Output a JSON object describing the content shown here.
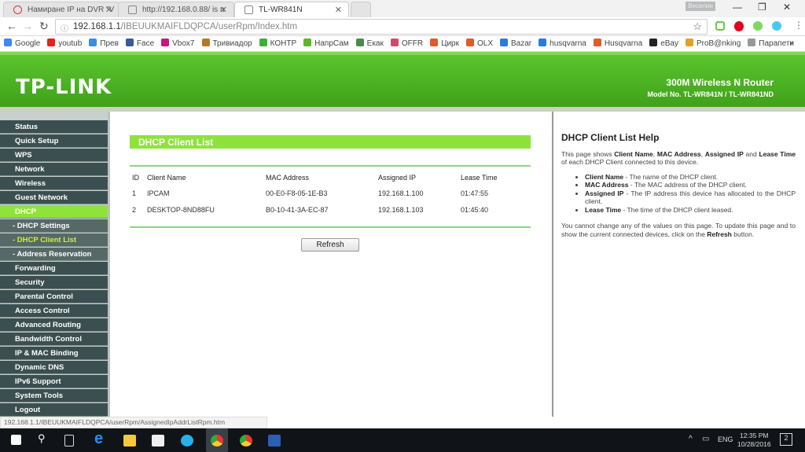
{
  "browser": {
    "tabs": [
      {
        "title": "Намиране IP на DVR \"V"
      },
      {
        "title": "http://192.168.0.88/ is n"
      },
      {
        "title": "TL-WR841N"
      }
    ],
    "user": "Веселин",
    "url_host": "192.168.1.1",
    "url_path": "/IBEUUKMAIFLDQPCA/userRpm/Index.htm",
    "bookmarks": [
      {
        "label": "Google",
        "color": "#4285f4"
      },
      {
        "label": "youtub",
        "color": "#e62117"
      },
      {
        "label": "Прев",
        "color": "#3b8de0"
      },
      {
        "label": "Face",
        "color": "#3b5998"
      },
      {
        "label": "Vbox7",
        "color": "#c2187e"
      },
      {
        "label": "Тривиадор",
        "color": "#b07a2a"
      },
      {
        "label": "КОНТР",
        "color": "#3ab03a"
      },
      {
        "label": "НапрСам",
        "color": "#5cb82a"
      },
      {
        "label": "Екак",
        "color": "#4a8a4a"
      },
      {
        "label": "OFFR",
        "color": "#d04a6a"
      },
      {
        "label": "Цирк",
        "color": "#e05a2a"
      },
      {
        "label": "OLX",
        "color": "#e05a2a"
      },
      {
        "label": "Bazar",
        "color": "#2a7ae0"
      },
      {
        "label": "husqvarna",
        "color": "#2a7ae0"
      },
      {
        "label": "Husqvarna",
        "color": "#e05a2a"
      },
      {
        "label": "eBay",
        "color": "#222"
      },
      {
        "label": "ProB@nking",
        "color": "#e0a02a"
      },
      {
        "label": "Парапети",
        "color": "#999"
      }
    ],
    "more": "»",
    "status_url": "192.168.1.1/IBEUUKMAIFLDQPCA/userRpm/AssignedIpAddrListRpm.htm"
  },
  "router": {
    "logo": "TP-LINK",
    "product": "300M Wireless N Router",
    "model": "Model No. TL-WR841N / TL-WR841ND",
    "menu": [
      "Status",
      "Quick Setup",
      "WPS",
      "Network",
      "Wireless",
      "Guest Network",
      "DHCP",
      "- DHCP Settings",
      "- DHCP Client List",
      "- Address Reservation",
      "Forwarding",
      "Security",
      "Parental Control",
      "Access Control",
      "Advanced Routing",
      "Bandwidth Control",
      "IP & MAC Binding",
      "Dynamic DNS",
      "IPv6 Support",
      "System Tools",
      "Logout"
    ],
    "page_title": "DHCP Client List",
    "columns": [
      "ID",
      "Client Name",
      "MAC Address",
      "Assigned IP",
      "Lease Time"
    ],
    "rows": [
      [
        "1",
        "IPCAM",
        "00-E0-F8-05-1E-B3",
        "192.168.1.100",
        "01:47:55"
      ],
      [
        "2",
        "DESKTOP-8ND88FU",
        "B0-10-41-3A-EC-87",
        "192.168.1.103",
        "01:45:40"
      ]
    ],
    "refresh": "Refresh",
    "help": {
      "title": "DHCP Client List Help",
      "p1a": "This page shows ",
      "p1b": "Client Name",
      "p1c": ", ",
      "p1d": "MAC Address",
      "p1e": ", ",
      "p1f": "Assigned IP",
      "p1g": " and ",
      "p1h": "Lease Time",
      "p1i": " of each DHCP Client connected to this device.",
      "items": [
        {
          "term": "Client Name",
          "desc": " - The name of the DHCP client."
        },
        {
          "term": "MAC Address",
          "desc": " - The MAC address of the DHCP client."
        },
        {
          "term": "Assigned IP",
          "desc": " - The IP address this device has allocated to the DHCP client."
        },
        {
          "term": "Lease Time",
          "desc": " - The time of the DHCP client leased."
        }
      ],
      "p2a": "You cannot change any of the values on this page. To update this page and to show the current connected devices, click on the ",
      "p2b": "Refresh",
      "p2c": " button."
    }
  },
  "taskbar": {
    "lang": "ENG",
    "time": "12:35 PM",
    "date": "10/28/2016",
    "notif": "2"
  }
}
